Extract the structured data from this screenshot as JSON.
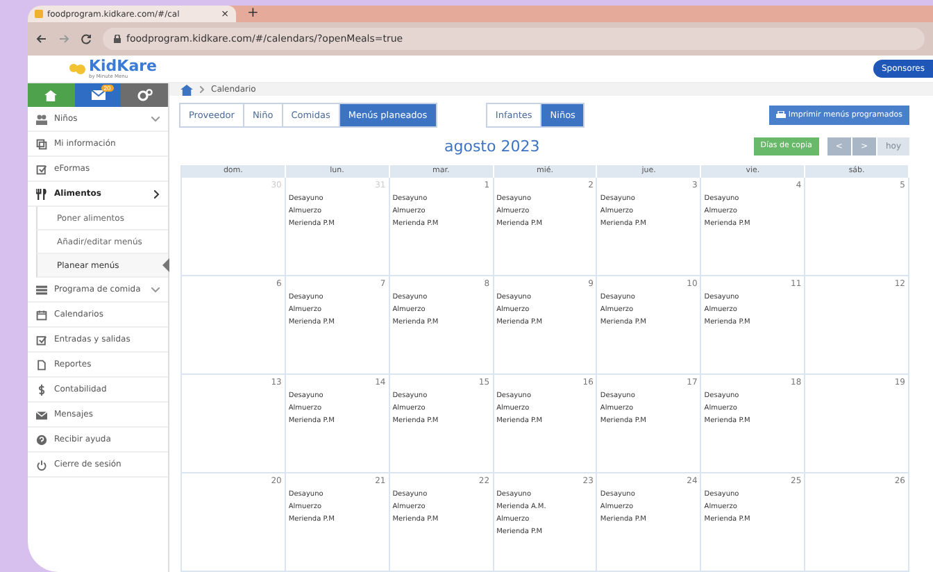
{
  "browser": {
    "tab_title": "foodprogram.kidkare.com/#/cal",
    "tab_close": "×",
    "new_tab": "+",
    "url": "foodprogram.kidkare.com/#/calendars/?openMeals=true"
  },
  "header": {
    "logo": "KidKare",
    "logo_sub": "by Minute Menu",
    "sponsor_button": "Sponsores"
  },
  "top_icons": [
    {
      "kind": "home"
    },
    {
      "kind": "mail",
      "badge": "20"
    },
    {
      "kind": "gears"
    }
  ],
  "sidebar": {
    "items": [
      {
        "kind": "group",
        "label": "Niños",
        "expanded": false,
        "selected": false
      },
      {
        "kind": "link",
        "label": "Mi información",
        "selected": false
      },
      {
        "kind": "link",
        "label": "eFormas",
        "selected": false
      },
      {
        "kind": "group",
        "label": "Alimentos",
        "expanded": true,
        "selected": true,
        "children": [
          {
            "label": "Poner alimentos",
            "selected": false
          },
          {
            "label": "Añadir/editar menús",
            "selected": false
          },
          {
            "label": "Planear menús",
            "selected": true
          }
        ]
      },
      {
        "kind": "group",
        "label": "Programa de comida",
        "expanded": false,
        "selected": false
      },
      {
        "kind": "link",
        "label": "Calendarios",
        "selected": false
      },
      {
        "kind": "link",
        "label": "Entradas y salidas",
        "selected": false
      },
      {
        "kind": "link",
        "label": "Reportes",
        "selected": false
      },
      {
        "kind": "link",
        "label": "Contabilidad",
        "selected": false
      },
      {
        "kind": "link",
        "label": "Mensajes",
        "selected": false
      },
      {
        "kind": "link",
        "label": "Recibir ayuda",
        "selected": false
      },
      {
        "kind": "link",
        "label": "Cierre de sesión",
        "selected": false
      }
    ]
  },
  "breadcrumb": {
    "current": "Calendario"
  },
  "view_tabs": [
    {
      "label": "Proveedor",
      "selected": false
    },
    {
      "label": "Niño",
      "selected": false
    },
    {
      "label": "Comidas",
      "selected": false
    },
    {
      "label": "Menús planeados",
      "selected": true
    }
  ],
  "age_tabs": [
    {
      "label": "Infantes",
      "selected": false
    },
    {
      "label": "Niños",
      "selected": true
    }
  ],
  "print_button": "Imprimir menús programados",
  "month_title": "agosto 2023",
  "copy_days_button": "Días de copia",
  "nav": {
    "prev": "<",
    "next": ">",
    "today": "hoy",
    "today_disabled": true
  },
  "weekdays": [
    "dom.",
    "lun.",
    "mar.",
    "mié.",
    "jue.",
    "vie.",
    "sáb."
  ],
  "weeks": [
    [
      {
        "day": "30",
        "muted": true
      },
      {
        "day": "31",
        "muted": true,
        "meals": [
          "Desayuno",
          "Almuerzo",
          "Merienda P.M"
        ]
      },
      {
        "day": "1",
        "muted": false,
        "meals": [
          "Desayuno",
          "Almuerzo",
          "Merienda P.M"
        ]
      },
      {
        "day": "2",
        "muted": false,
        "meals": [
          "Desayuno",
          "Almuerzo",
          "Merienda P.M"
        ]
      },
      {
        "day": "3",
        "muted": false,
        "meals": [
          "Desayuno",
          "Almuerzo",
          "Merienda P.M"
        ]
      },
      {
        "day": "4",
        "muted": false,
        "meals": [
          "Desayuno",
          "Almuerzo",
          "Merienda P.M"
        ]
      },
      {
        "day": "5",
        "muted": false
      }
    ],
    [
      {
        "day": "6",
        "muted": false
      },
      {
        "day": "7",
        "muted": false,
        "meals": [
          "Desayuno",
          "Almuerzo",
          "Merienda P.M"
        ]
      },
      {
        "day": "8",
        "muted": false,
        "meals": [
          "Desayuno",
          "Almuerzo",
          "Merienda P.M"
        ]
      },
      {
        "day": "9",
        "muted": false,
        "meals": [
          "Desayuno",
          "Almuerzo",
          "Merienda P.M"
        ]
      },
      {
        "day": "10",
        "muted": false,
        "meals": [
          "Desayuno",
          "Almuerzo",
          "Merienda P.M"
        ]
      },
      {
        "day": "11",
        "muted": false,
        "meals": [
          "Desayuno",
          "Almuerzo",
          "Merienda P.M"
        ]
      },
      {
        "day": "12",
        "muted": false
      }
    ],
    [
      {
        "day": "13",
        "muted": false
      },
      {
        "day": "14",
        "muted": false,
        "meals": [
          "Desayuno",
          "Almuerzo",
          "Merienda P.M"
        ]
      },
      {
        "day": "15",
        "muted": false,
        "meals": [
          "Desayuno",
          "Almuerzo",
          "Merienda P.M"
        ]
      },
      {
        "day": "16",
        "muted": false,
        "meals": [
          "Desayuno",
          "Almuerzo",
          "Merienda P.M"
        ]
      },
      {
        "day": "17",
        "muted": false,
        "meals": [
          "Desayuno",
          "Almuerzo",
          "Merienda P.M"
        ]
      },
      {
        "day": "18",
        "muted": false,
        "meals": [
          "Desayuno",
          "Almuerzo",
          "Merienda P.M"
        ]
      },
      {
        "day": "19",
        "muted": false
      }
    ],
    [
      {
        "day": "20",
        "muted": false
      },
      {
        "day": "21",
        "muted": false,
        "meals": [
          "Desayuno",
          "Almuerzo",
          "Merienda P.M"
        ]
      },
      {
        "day": "22",
        "muted": false,
        "meals": [
          "Desayuno",
          "Almuerzo",
          "Merienda P.M"
        ]
      },
      {
        "day": "23",
        "muted": false,
        "meals": [
          "Desayuno",
          "Merienda A.M.",
          "Almuerzo",
          "Merienda P.M"
        ]
      },
      {
        "day": "24",
        "muted": false,
        "meals": [
          "Desayuno",
          "Almuerzo",
          "Merienda P.M"
        ]
      },
      {
        "day": "25",
        "muted": false,
        "meals": [
          "Desayuno",
          "Almuerzo",
          "Merienda P.M"
        ]
      },
      {
        "day": "26",
        "muted": false
      }
    ]
  ]
}
